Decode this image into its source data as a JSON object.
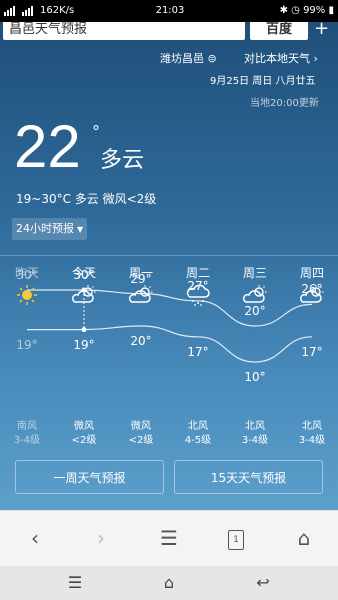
{
  "statusbar": {
    "signal": "",
    "net_speed": "162K/s",
    "time": "21:03",
    "battery": "99%"
  },
  "search": {
    "query": "昌邑天气预报",
    "button": "百度",
    "plus": "+"
  },
  "location": {
    "city": "潍坊昌邑",
    "compare": "对比本地天气",
    "date": "9月25日 周日 八月廿五",
    "updated": "当地20:00更新"
  },
  "current": {
    "temp": "22",
    "deg": "°",
    "condition": "多云",
    "range": "19~30°C  多云  微风<2级",
    "hourly_button": "24小时预报"
  },
  "forecast": {
    "days": [
      {
        "label": "昨天",
        "icon": "sun-icon",
        "hi": "30°",
        "lo": "19°",
        "wind_dir": "南风",
        "wind_lvl": "3-4级"
      },
      {
        "label": "今天",
        "icon": "partly-cloudy-icon",
        "hi": "30°",
        "lo": "19°",
        "wind_dir": "微风",
        "wind_lvl": "<2级"
      },
      {
        "label": "周一",
        "icon": "partly-cloudy-icon",
        "hi": "29°",
        "lo": "20°",
        "wind_dir": "微风",
        "wind_lvl": "<2级"
      },
      {
        "label": "周二",
        "icon": "rain-cloud-icon",
        "hi": "27°",
        "lo": "17°",
        "wind_dir": "北风",
        "wind_lvl": "4-5级"
      },
      {
        "label": "周三",
        "icon": "partly-cloudy-icon",
        "hi": "20°",
        "lo": "10°",
        "wind_dir": "北风",
        "wind_lvl": "3-4级"
      },
      {
        "label": "周四",
        "icon": "partly-cloudy-icon",
        "hi": "26°",
        "lo": "17°",
        "wind_dir": "北风",
        "wind_lvl": "3-4级"
      }
    ],
    "week_button": "一周天气预报",
    "fifteen_button": "15天天气预报"
  },
  "browser_bar": [
    "back-icon",
    "forward-icon",
    "menu-icon",
    "tabs-icon",
    "home-icon"
  ],
  "tab_count": "1",
  "nav_bar": [
    "menu-icon",
    "home-icon",
    "back-icon"
  ]
}
